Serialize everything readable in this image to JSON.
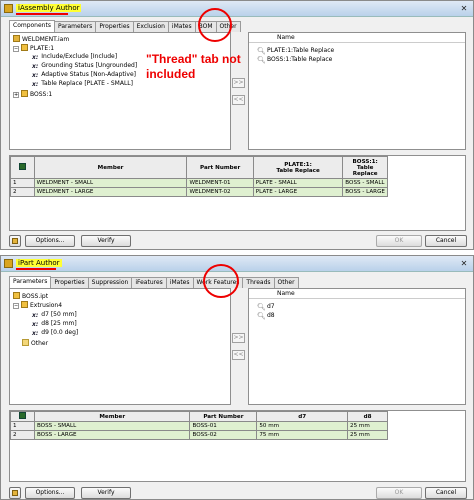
{
  "dialog1": {
    "title": "iAssembly Author",
    "tabs": [
      "Components",
      "Parameters",
      "Properties",
      "Exclusion",
      "iMates",
      "BOM",
      "Other"
    ],
    "tree": [
      {
        "label": "WELDMENT.iam",
        "kind": "asm",
        "level": 0
      },
      {
        "label": "PLATE:1",
        "kind": "part",
        "level": 1
      },
      {
        "label": "Include/Exclude [Include]",
        "kind": "param",
        "level": 2
      },
      {
        "label": "Grounding Status [Ungrounded]",
        "kind": "param",
        "level": 2
      },
      {
        "label": "Adaptive Status [Non-Adaptive]",
        "kind": "param",
        "level": 2
      },
      {
        "label": "Table Replace [PLATE - SMALL]",
        "kind": "param",
        "level": 2
      },
      {
        "label": "BOSS:1",
        "kind": "part",
        "level": 1
      }
    ],
    "list_header": "Name",
    "list_items": [
      "PLATE:1:Table Replace",
      "BOSS:1:Table Replace"
    ],
    "move_right": ">>",
    "move_left": "<<",
    "table": {
      "headers": [
        "Member",
        "Part Number",
        "PLATE:1:\nTable Replace",
        "BOSS:1:\nTable\nReplace"
      ],
      "rows": [
        {
          "num": "1",
          "cells": [
            "WELDMENT - SMALL",
            "WELDMENT-01",
            "PLATE - SMALL",
            "BOSS - SMALL"
          ]
        },
        {
          "num": "2",
          "cells": [
            "WELDMENT - LARGE",
            "WELDMENT-02",
            "PLATE - LARGE",
            "BOSS - LARGE"
          ]
        }
      ]
    },
    "buttons": {
      "options": "Options...",
      "verify": "Verify",
      "ok": "OK",
      "cancel": "Cancel"
    }
  },
  "dialog2": {
    "title": "iPart Author",
    "tabs": [
      "Parameters",
      "Properties",
      "Suppression",
      "iFeatures",
      "iMates",
      "Work Features",
      "Threads",
      "Other"
    ],
    "tree": [
      {
        "label": "BOSS.ipt",
        "kind": "part",
        "level": 0
      },
      {
        "label": "Extrusion4",
        "kind": "part",
        "level": 1
      },
      {
        "label": "d7 [50 mm]",
        "kind": "param",
        "level": 2
      },
      {
        "label": "d8 [25 mm]",
        "kind": "param",
        "level": 2
      },
      {
        "label": "d9 [0.0 deg]",
        "kind": "param",
        "level": 2
      },
      {
        "label": "Other",
        "kind": "folder",
        "level": 1
      }
    ],
    "list_header": "Name",
    "list_items": [
      "d7",
      "d8"
    ],
    "move_right": ">>",
    "move_left": "<<",
    "table": {
      "headers": [
        "Member",
        "Part Number",
        "d7",
        "d8"
      ],
      "rows": [
        {
          "num": "1",
          "cells": [
            "BOSS - SMALL",
            "BOSS-01",
            "50 mm",
            "25 mm"
          ]
        },
        {
          "num": "2",
          "cells": [
            "BOSS - LARGE",
            "BOSS-02",
            "75 mm",
            "25 mm"
          ]
        }
      ]
    },
    "buttons": {
      "options": "Options...",
      "verify": "Verify",
      "ok": "OK",
      "cancel": "Cancel"
    }
  },
  "annotation": {
    "text": "\"Thread\" tab not included",
    "color": "#e00000"
  },
  "colors": {
    "highlight": "#ffff33",
    "row_green": "#dff0d0",
    "annotation_red": "#e00000"
  }
}
